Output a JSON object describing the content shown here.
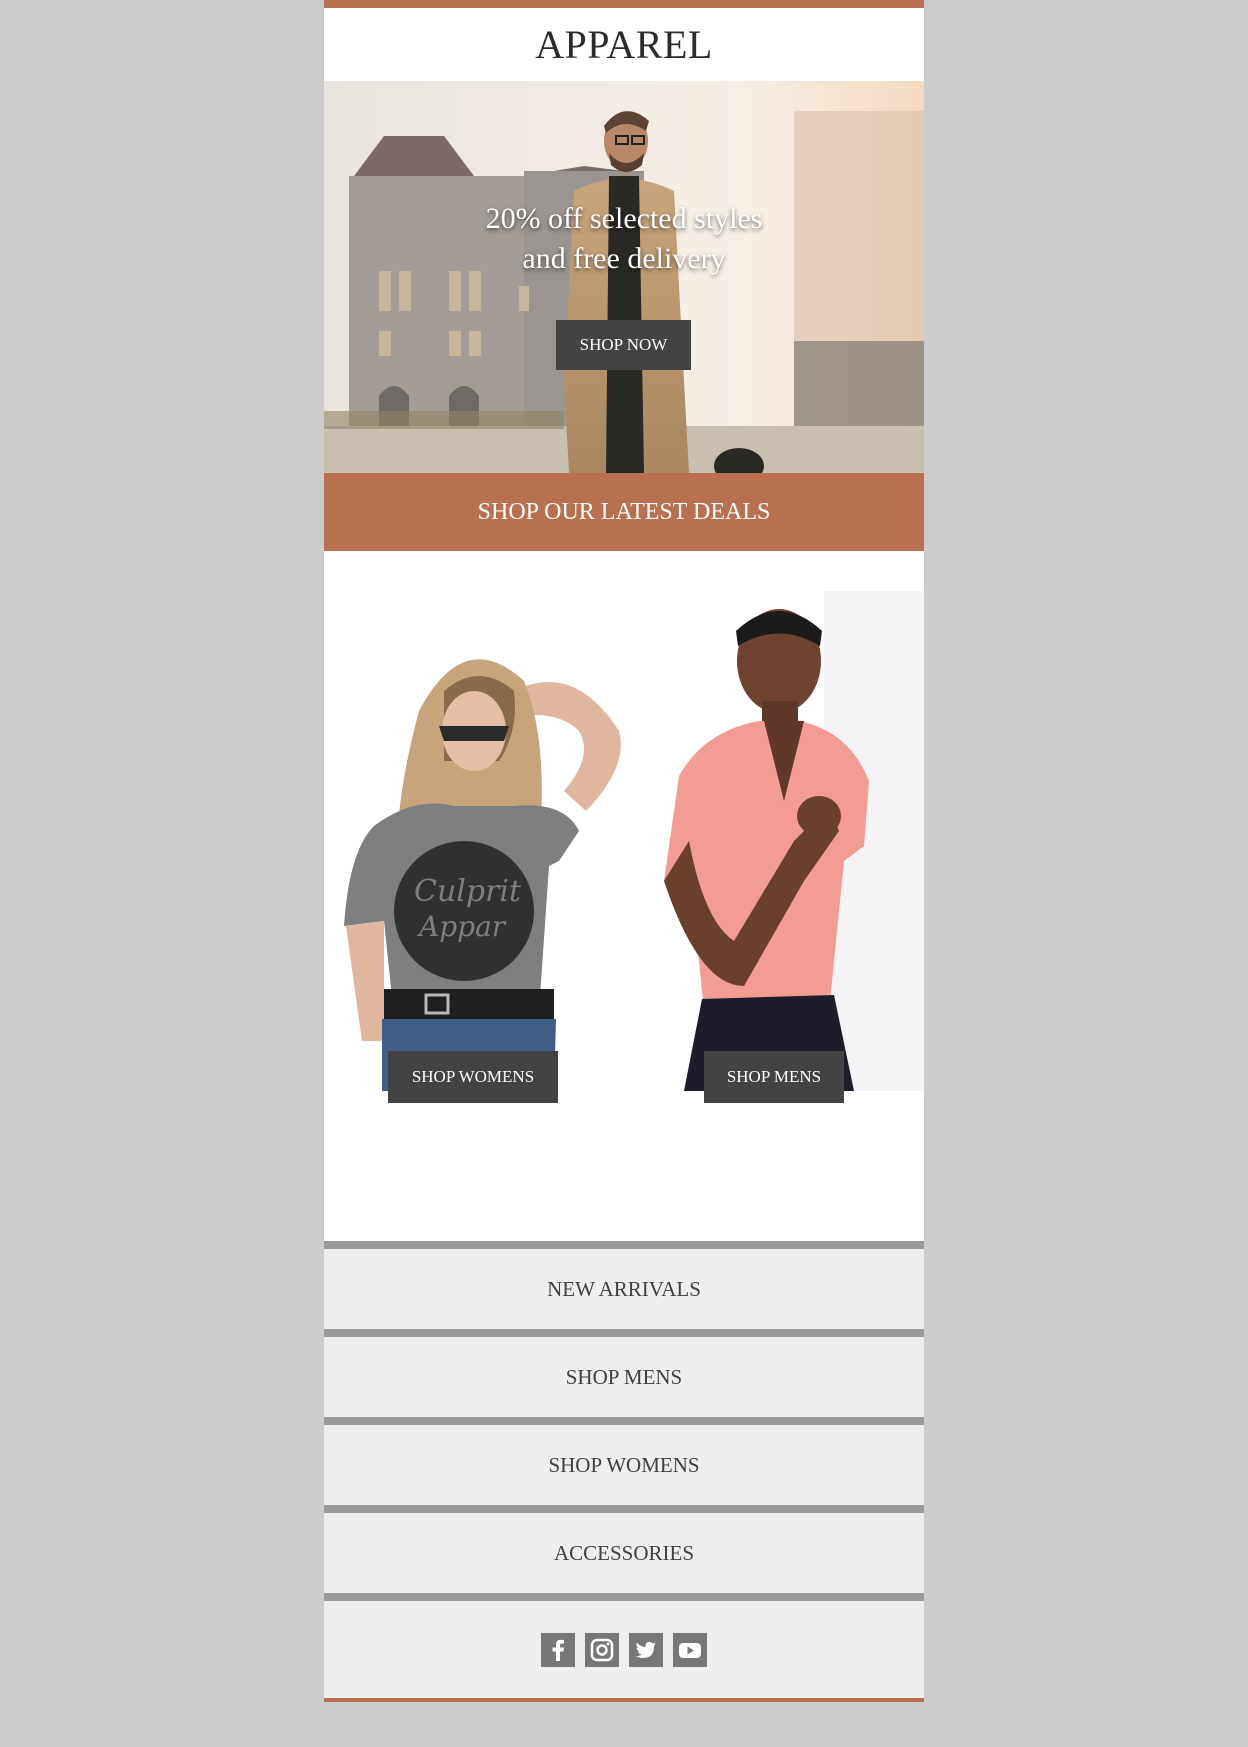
{
  "brand": {
    "name": "APPAREL"
  },
  "hero": {
    "headline_line1": "20% off selected styles",
    "headline_line2": "and free delivery",
    "button_label": "SHOP NOW"
  },
  "deals": {
    "heading": "SHOP OUR LATEST DEALS"
  },
  "products": {
    "womens_button": "SHOP WOMENS",
    "mens_button": "SHOP MENS",
    "womens_shirt_print_1": "Culprit",
    "womens_shirt_print_2": "Appar"
  },
  "nav": {
    "items": [
      {
        "label": "NEW ARRIVALS"
      },
      {
        "label": "SHOP MENS"
      },
      {
        "label": "SHOP WOMENS"
      },
      {
        "label": "ACCESSORIES"
      }
    ]
  },
  "social": {
    "icons": [
      "facebook-icon",
      "instagram-icon",
      "twitter-icon",
      "youtube-icon"
    ]
  },
  "colors": {
    "accent": "#b87050",
    "button": "#434343",
    "nav_background": "#eeeeee",
    "nav_divider": "#999999",
    "page_background": "#cccccc"
  }
}
